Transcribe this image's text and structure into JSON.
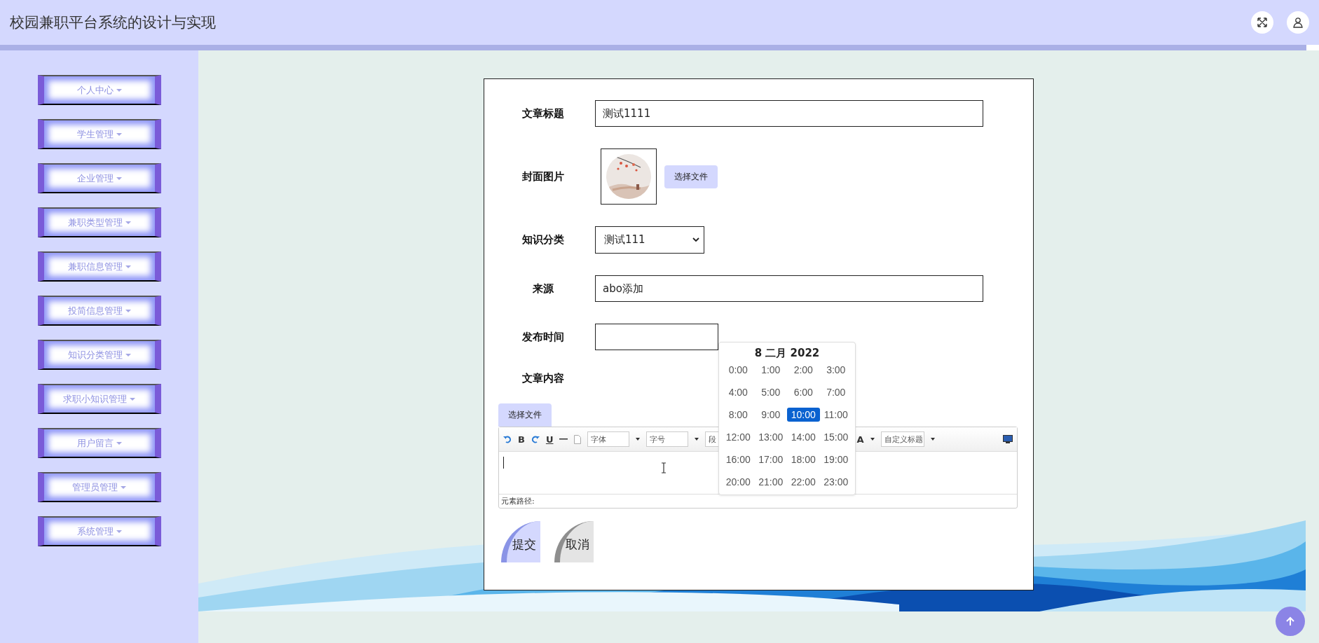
{
  "header": {
    "title": "校园兼职平台系统的设计与实现"
  },
  "sidebar": {
    "items": [
      {
        "label": "个人中心"
      },
      {
        "label": "学生管理"
      },
      {
        "label": "企业管理"
      },
      {
        "label": "兼职类型管理"
      },
      {
        "label": "兼职信息管理"
      },
      {
        "label": "投简信息管理"
      },
      {
        "label": "知识分类管理"
      },
      {
        "label": "求职小知识管理"
      },
      {
        "label": "用户留言"
      },
      {
        "label": "管理员管理"
      },
      {
        "label": "系统管理"
      }
    ]
  },
  "form": {
    "fields": [
      {
        "kind": "text",
        "label": "文章标题",
        "value": "测试1111"
      },
      {
        "label": "封面图片",
        "button": "选择文件"
      },
      {
        "kind": "select",
        "label": "知识分类",
        "value": "测试111"
      },
      {
        "kind": "text",
        "label": "来源",
        "value": "abo添加"
      },
      {
        "kind": "date",
        "label": "发布时间"
      }
    ],
    "content_label": "文章内容",
    "editor": {
      "upload_button": "选择文件",
      "bold": "B",
      "underline": "U",
      "selects": [
        "字体",
        "字号",
        "段"
      ],
      "font_color": "A",
      "heading_select": "自定义标题",
      "status": "元素路径:"
    },
    "buttons": [
      {
        "kind": "submit",
        "label": "提交"
      },
      {
        "kind": "cancel",
        "label": "取消"
      }
    ]
  },
  "date_picker": {
    "heading": "8 二月 2022",
    "hours": [
      {
        "label": "0:00",
        "selected": false
      },
      {
        "label": "1:00",
        "selected": false
      },
      {
        "label": "2:00",
        "selected": false
      },
      {
        "label": "3:00",
        "selected": false
      },
      {
        "label": "4:00",
        "selected": false
      },
      {
        "label": "5:00",
        "selected": false
      },
      {
        "label": "6:00",
        "selected": false
      },
      {
        "label": "7:00",
        "selected": false
      },
      {
        "label": "8:00",
        "selected": false
      },
      {
        "label": "9:00",
        "selected": false
      },
      {
        "label": "10:00",
        "selected": true
      },
      {
        "label": "11:00",
        "selected": false
      },
      {
        "label": "12:00",
        "selected": false
      },
      {
        "label": "13:00",
        "selected": false
      },
      {
        "label": "14:00",
        "selected": false
      },
      {
        "label": "15:00",
        "selected": false
      },
      {
        "label": "16:00",
        "selected": false
      },
      {
        "label": "17:00",
        "selected": false
      },
      {
        "label": "18:00",
        "selected": false
      },
      {
        "label": "19:00",
        "selected": false
      },
      {
        "label": "20:00",
        "selected": false
      },
      {
        "label": "21:00",
        "selected": false
      },
      {
        "label": "22:00",
        "selected": false
      },
      {
        "label": "23:00",
        "selected": false
      }
    ]
  }
}
